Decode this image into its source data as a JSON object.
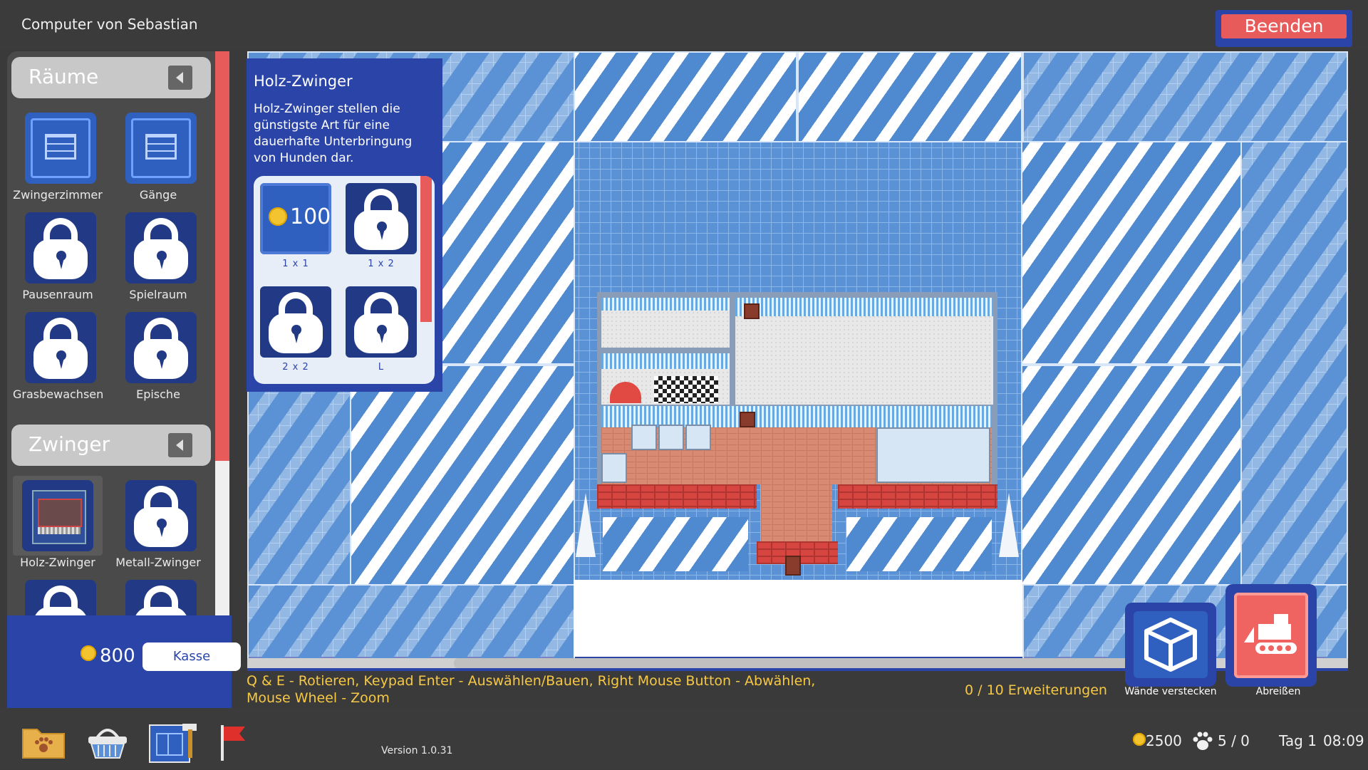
{
  "window": {
    "title": "Computer von Sebastian",
    "quit_label": "Beenden"
  },
  "sidebar": {
    "categories": [
      {
        "title": "Räume",
        "items": [
          {
            "label": "Zwingerzimmer",
            "locked": false
          },
          {
            "label": "Gänge",
            "locked": false
          },
          {
            "label": "Pausenraum",
            "locked": true
          },
          {
            "label": "Spielraum",
            "locked": true
          },
          {
            "label": "Grasbewachsene Spielraum",
            "locked": true
          },
          {
            "label": "Epische Spielräume",
            "locked": true
          }
        ]
      },
      {
        "title": "Zwinger",
        "items": [
          {
            "label": "Holz-Zwinger",
            "locked": false,
            "selected": true
          },
          {
            "label": "Metall-Zwinger",
            "locked": true
          },
          {
            "label": "",
            "locked": true
          },
          {
            "label": "",
            "locked": true
          }
        ]
      }
    ]
  },
  "wallet": {
    "amount": "800",
    "checkout_label": "Kasse"
  },
  "info": {
    "title": "Holz-Zwinger",
    "description": "Holz-Zwinger stellen die günstigste Art für eine dauerhafte Unterbringung von Hunden dar.",
    "shapes": [
      {
        "label": "1 x 1",
        "price": "100",
        "locked": false
      },
      {
        "label": "1 x 2",
        "locked": true
      },
      {
        "label": "2 x 2",
        "locked": true
      },
      {
        "label": "L",
        "locked": true
      }
    ]
  },
  "hint": "Q & E - Rotieren, Keypad Enter - Auswählen/Bauen, Right Mouse Button - Abwählen, Mouse Wheel - Zoom",
  "expansions": {
    "current": "0",
    "max": "10",
    "text": "0 / 10  Erweiterungen"
  },
  "actions": {
    "hide_walls": "Wände verstecken",
    "demolish": "Abreißen"
  },
  "footer": {
    "version": "Version 1.0.31",
    "money": "2500",
    "dogs": "5 / 0",
    "day": "Tag 1",
    "time": "08:09"
  },
  "colors": {
    "accent_blue": "#2b44a8",
    "accent_red": "#e85b5b",
    "hint_yellow": "#f6c844"
  }
}
